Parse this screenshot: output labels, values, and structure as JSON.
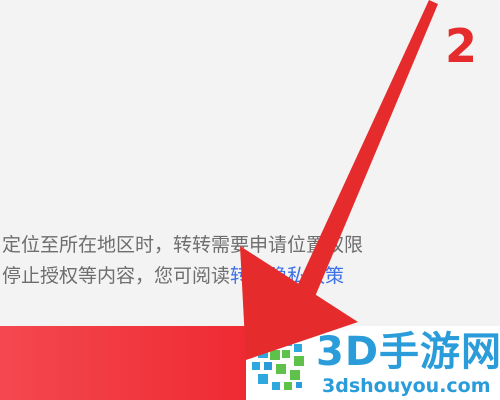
{
  "annotation": {
    "step_number": "2",
    "arrow_color": "#e52b2b"
  },
  "privacy_notice": {
    "line1": "定位至所在地区时，转转需要申请位置权限",
    "line2_prefix": "停止授权等内容，您可阅读",
    "link_text": "转转隐私政策"
  },
  "agree_button": {
    "color": "#ef2a33"
  },
  "watermark": {
    "brand": "3D手游网",
    "url": "3dshouyou.com",
    "color": "#2a9cd9",
    "icon": "3d-cube-logo-icon"
  }
}
